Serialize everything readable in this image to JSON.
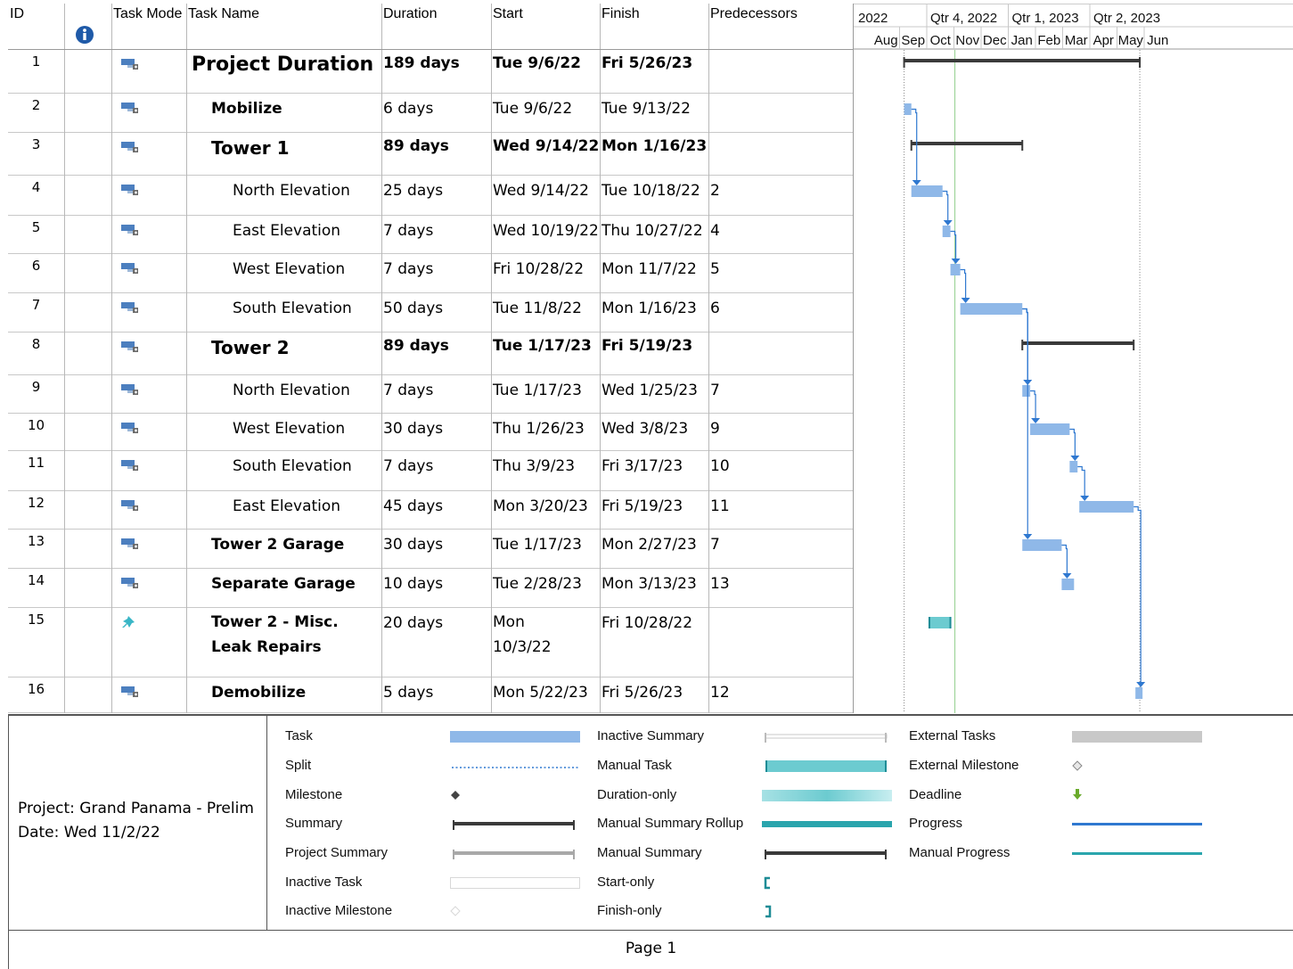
{
  "columns": {
    "id": "ID",
    "indicator_icon": "info-icon",
    "task_mode": "Task Mode",
    "task_name": "Task Name",
    "duration": "Duration",
    "start": "Start",
    "finish": "Finish",
    "predecessors": "Predecessors"
  },
  "timescale": {
    "top": [
      "2022",
      "Qtr 4, 2022",
      "Qtr 1, 2023",
      "Qtr 2, 2023"
    ],
    "bottom": [
      "Aug",
      "Sep",
      "Oct",
      "Nov",
      "Dec",
      "Jan",
      "Feb",
      "Mar",
      "Apr",
      "May",
      "Jun"
    ]
  },
  "tasks": [
    {
      "id": "1",
      "name": "Project Duration",
      "duration": "189 days",
      "start": "Tue 9/6/22",
      "finish": "Fri 5/26/23",
      "pred": "",
      "level": 0,
      "style": "project",
      "mode": "auto"
    },
    {
      "id": "2",
      "name": "Mobilize",
      "duration": "6 days",
      "start": "Tue 9/6/22",
      "finish": "Tue 9/13/22",
      "pred": "",
      "level": 1,
      "style": "summary-name",
      "mode": "auto"
    },
    {
      "id": "3",
      "name": "Tower 1",
      "duration": "89 days",
      "start": "Wed 9/14/22",
      "finish": "Mon 1/16/23",
      "pred": "",
      "level": 1,
      "style": "summary",
      "mode": "auto"
    },
    {
      "id": "4",
      "name": "North Elevation",
      "duration": "25 days",
      "start": "Wed 9/14/22",
      "finish": "Tue 10/18/22",
      "pred": "2",
      "level": 2,
      "style": "normal",
      "mode": "auto"
    },
    {
      "id": "5",
      "name": "East Elevation",
      "duration": "7 days",
      "start": "Wed 10/19/22",
      "finish": "Thu 10/27/22",
      "pred": "4",
      "level": 2,
      "style": "normal",
      "mode": "auto"
    },
    {
      "id": "6",
      "name": "West Elevation",
      "duration": "7 days",
      "start": "Fri 10/28/22",
      "finish": "Mon 11/7/22",
      "pred": "5",
      "level": 2,
      "style": "normal",
      "mode": "auto"
    },
    {
      "id": "7",
      "name": "South Elevation",
      "duration": "50 days",
      "start": "Tue 11/8/22",
      "finish": "Mon 1/16/23",
      "pred": "6",
      "level": 2,
      "style": "normal",
      "mode": "auto"
    },
    {
      "id": "8",
      "name": "Tower 2",
      "duration": "89 days",
      "start": "Tue 1/17/23",
      "finish": "Fri 5/19/23",
      "pred": "",
      "level": 1,
      "style": "summary",
      "mode": "auto"
    },
    {
      "id": "9",
      "name": "North Elevation",
      "duration": "7 days",
      "start": "Tue 1/17/23",
      "finish": "Wed 1/25/23",
      "pred": "7",
      "level": 2,
      "style": "normal",
      "mode": "auto"
    },
    {
      "id": "10",
      "name": "West Elevation",
      "duration": "30 days",
      "start": "Thu 1/26/23",
      "finish": "Wed 3/8/23",
      "pred": "9",
      "level": 2,
      "style": "normal",
      "mode": "auto"
    },
    {
      "id": "11",
      "name": "South Elevation",
      "duration": "7 days",
      "start": "Thu 3/9/23",
      "finish": "Fri 3/17/23",
      "pred": "10",
      "level": 2,
      "style": "normal",
      "mode": "auto"
    },
    {
      "id": "12",
      "name": "East Elevation",
      "duration": "45 days",
      "start": "Mon 3/20/23",
      "finish": "Fri 5/19/23",
      "pred": "11",
      "level": 2,
      "style": "normal",
      "mode": "auto"
    },
    {
      "id": "13",
      "name": "Tower 2 Garage",
      "duration": "30 days",
      "start": "Tue 1/17/23",
      "finish": "Mon 2/27/23",
      "pred": "7",
      "level": 1,
      "style": "summary-name",
      "mode": "auto"
    },
    {
      "id": "14",
      "name": "Separate Garage",
      "duration": "10 days",
      "start": "Tue 2/28/23",
      "finish": "Mon 3/13/23",
      "pred": "13",
      "level": 1,
      "style": "summary-name",
      "mode": "auto"
    },
    {
      "id": "15",
      "name": "Tower 2 - Misc. Leak Repairs",
      "duration": "20 days",
      "start": "Mon 10/3/22",
      "finish": "Fri 10/28/22",
      "pred": "",
      "level": 1,
      "style": "summary-name",
      "mode": "manual"
    },
    {
      "id": "16",
      "name": "Demobilize",
      "duration": "5 days",
      "start": "Mon 5/22/23",
      "finish": "Fri 5/26/23",
      "pred": "12",
      "level": 1,
      "style": "summary-name",
      "mode": "auto"
    }
  ],
  "info": {
    "project": "Project: Grand Panama - Prelim",
    "date": "Date: Wed 11/2/22"
  },
  "legend": [
    {
      "label": "Task",
      "symbol": "task"
    },
    {
      "label": "Split",
      "symbol": "split"
    },
    {
      "label": "Milestone",
      "symbol": "milestone"
    },
    {
      "label": "Summary",
      "symbol": "summary"
    },
    {
      "label": "Project Summary",
      "symbol": "project-summary"
    },
    {
      "label": "Inactive Task",
      "symbol": "inactive-task"
    },
    {
      "label": "Inactive Milestone",
      "symbol": "inactive-milestone"
    },
    {
      "label": "Inactive Summary",
      "symbol": "inactive-summary"
    },
    {
      "label": "Manual Task",
      "symbol": "manual-task"
    },
    {
      "label": "Duration-only",
      "symbol": "duration-only"
    },
    {
      "label": "Manual Summary Rollup",
      "symbol": "manual-summary-rollup"
    },
    {
      "label": "Manual Summary",
      "symbol": "manual-summary"
    },
    {
      "label": "Start-only",
      "symbol": "start-only"
    },
    {
      "label": "Finish-only",
      "symbol": "finish-only"
    },
    {
      "label": "External Tasks",
      "symbol": "external-tasks"
    },
    {
      "label": "External Milestone",
      "symbol": "external-milestone"
    },
    {
      "label": "Deadline",
      "symbol": "deadline"
    },
    {
      "label": "Progress",
      "symbol": "progress"
    },
    {
      "label": "Manual Progress",
      "symbol": "manual-progress"
    }
  ],
  "footer": {
    "page": "Page 1"
  },
  "colors": {
    "task": "#8fb8e8",
    "summary": "#3a3a3a",
    "link": "#2f78d0",
    "manual": "#6ccbd0",
    "status_date_line": "#9fd49a",
    "gridline": "#c8c8c8"
  }
}
